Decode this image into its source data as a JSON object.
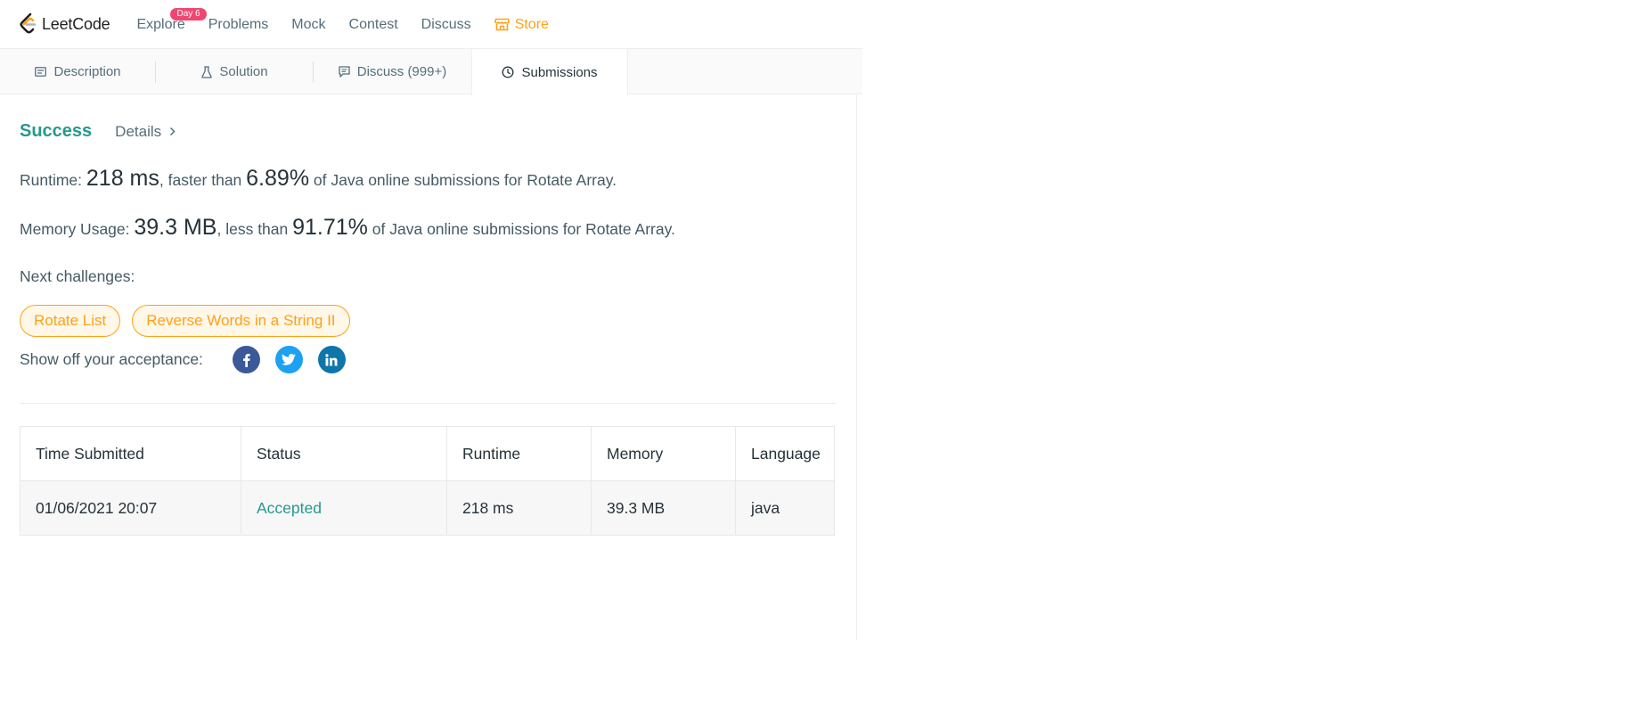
{
  "nav": {
    "logo_text": "LeetCode",
    "items": [
      {
        "label": "Explore",
        "badge": "Day 6"
      },
      {
        "label": "Problems"
      },
      {
        "label": "Mock"
      },
      {
        "label": "Contest"
      },
      {
        "label": "Discuss"
      }
    ],
    "store_label": "Store",
    "accent_color": "#ffa116"
  },
  "tabs": [
    {
      "label": "Description",
      "icon": "description-icon"
    },
    {
      "label": "Solution",
      "icon": "flask-icon"
    },
    {
      "label": "Discuss (999+)",
      "icon": "comment-icon"
    },
    {
      "label": "Submissions",
      "icon": "clock-icon",
      "active": true
    }
  ],
  "result": {
    "status": "Success",
    "details_label": "Details",
    "runtime": {
      "prefix": "Runtime: ",
      "value": "218 ms",
      "mid": ", faster than ",
      "percent": "6.89%",
      "suffix": " of Java online submissions for Rotate Array."
    },
    "memory": {
      "prefix": "Memory Usage: ",
      "value": "39.3 MB",
      "mid": ", less than ",
      "percent": "91.71%",
      "suffix": " of Java online submissions for Rotate Array."
    },
    "next_label": "Next challenges:",
    "challenges": [
      "Rotate List",
      "Reverse Words in a String II"
    ],
    "share_label": "Show off your acceptance:",
    "social": [
      "facebook-icon",
      "twitter-icon",
      "linkedin-icon"
    ]
  },
  "table": {
    "headers": [
      "Time Submitted",
      "Status",
      "Runtime",
      "Memory",
      "Language"
    ],
    "rows": [
      {
        "time": "01/06/2021 20:07",
        "status": "Accepted",
        "runtime": "218 ms",
        "memory": "39.3 MB",
        "language": "java"
      }
    ]
  }
}
